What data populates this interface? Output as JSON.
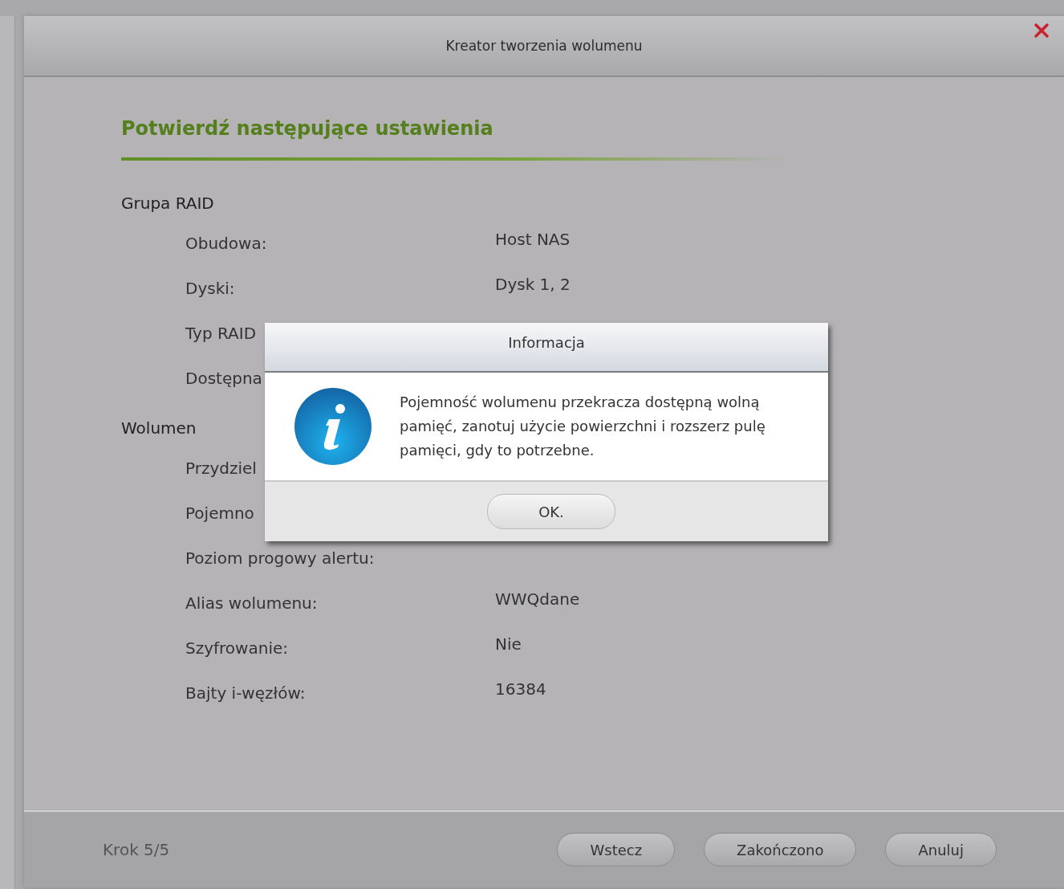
{
  "window": {
    "title": "Kreator tworzenia wolumenu"
  },
  "heading": "Potwierdź następujące ustawienia",
  "groups": [
    {
      "title": "Grupa RAID",
      "items": [
        {
          "label": "Obudowa:",
          "value": "Host NAS"
        },
        {
          "label": "Dyski:",
          "value": "Dysk 1, 2"
        },
        {
          "label": "Typ RAID"
        },
        {
          "label": "Dostępna"
        }
      ]
    },
    {
      "title": "Wolumen",
      "items": [
        {
          "label": "Przydziel"
        },
        {
          "label": "Pojemno"
        },
        {
          "label": "Poziom progowy alertu:"
        },
        {
          "label": "Alias wolumenu:",
          "value": "WWQdane"
        },
        {
          "label": "Szyfrowanie:",
          "value": "Nie"
        },
        {
          "label": "Bajty i-węzłów:",
          "value": "16384"
        }
      ]
    }
  ],
  "footer": {
    "step": "Krok 5/5",
    "buttons": [
      "Wstecz",
      "Zakończono",
      "Anuluj"
    ]
  },
  "dialog": {
    "title": "Informacja",
    "message": "Pojemność wolumenu przekracza dostępną wolną pamięć, zanotuj użycie powierzchni i rozszerz pulę pamięci, gdy to potrzebne.",
    "button": "OK."
  }
}
